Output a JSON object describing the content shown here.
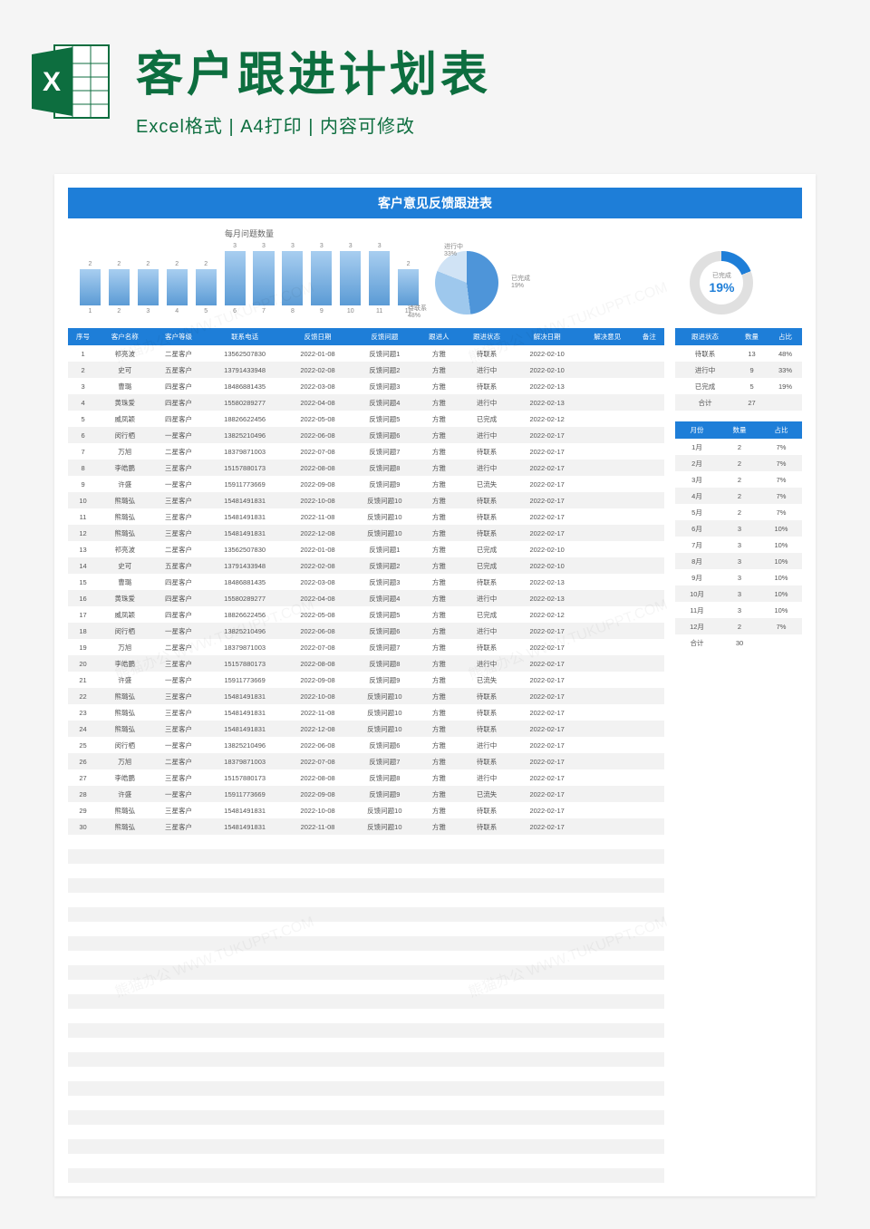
{
  "header": {
    "title": "客户跟进计划表",
    "subtitle": "Excel格式 | A4打印 | 内容可修改"
  },
  "sheet": {
    "title": "客户意见反馈跟进表",
    "barChartTitle": "每月问题数量",
    "donut": {
      "label": "已完成",
      "pct": "19%"
    },
    "pieLegend": [
      {
        "name": "已完成",
        "pct": "19%"
      },
      {
        "name": "待联系",
        "pct": "48%"
      },
      {
        "name": "进行中",
        "pct": "33%"
      }
    ]
  },
  "chart_data": {
    "bar": {
      "type": "bar",
      "title": "每月问题数量",
      "categories": [
        "1",
        "2",
        "3",
        "4",
        "5",
        "6",
        "7",
        "8",
        "9",
        "10",
        "11",
        "12"
      ],
      "values": [
        2,
        2,
        2,
        2,
        2,
        3,
        3,
        3,
        3,
        3,
        3,
        2
      ],
      "ylim": [
        0,
        3
      ]
    },
    "pie": {
      "type": "pie",
      "series": [
        {
          "name": "待联系",
          "value": 48
        },
        {
          "name": "进行中",
          "value": 33
        },
        {
          "name": "已完成",
          "value": 19
        }
      ]
    },
    "donut": {
      "type": "pie",
      "title": "已完成",
      "value": 19
    }
  },
  "mainHeaders": [
    "序号",
    "客户名称",
    "客户等级",
    "联系电话",
    "反馈日期",
    "反馈问题",
    "跟进人",
    "跟进状态",
    "解决日期",
    "解决意见",
    "备注"
  ],
  "mainRows": [
    [
      "1",
      "祁亮波",
      "二星客户",
      "13562507830",
      "2022-01-08",
      "反馈问题1",
      "方雅",
      "待联系",
      "2022-02-10",
      "",
      ""
    ],
    [
      "2",
      "史可",
      "五星客户",
      "13791433948",
      "2022-02-08",
      "反馈问题2",
      "方雅",
      "进行中",
      "2022-02-10",
      "",
      ""
    ],
    [
      "3",
      "曹璐",
      "四星客户",
      "18486881435",
      "2022-03-08",
      "反馈问题3",
      "方雅",
      "待联系",
      "2022-02-13",
      "",
      ""
    ],
    [
      "4",
      "黄珠爱",
      "四星客户",
      "15580289277",
      "2022-04-08",
      "反馈问题4",
      "方雅",
      "进行中",
      "2022-02-13",
      "",
      ""
    ],
    [
      "5",
      "威凤颖",
      "四星客户",
      "18826622456",
      "2022-05-08",
      "反馈问题5",
      "方雅",
      "已完成",
      "2022-02-12",
      "",
      ""
    ],
    [
      "6",
      "闵行栖",
      "一星客户",
      "13825210496",
      "2022-06-08",
      "反馈问题6",
      "方雅",
      "进行中",
      "2022-02-17",
      "",
      ""
    ],
    [
      "7",
      "万旭",
      "二星客户",
      "18379871003",
      "2022-07-08",
      "反馈问题7",
      "方雅",
      "待联系",
      "2022-02-17",
      "",
      ""
    ],
    [
      "8",
      "李皓鹏",
      "三星客户",
      "15157880173",
      "2022-08-08",
      "反馈问题8",
      "方雅",
      "进行中",
      "2022-02-17",
      "",
      ""
    ],
    [
      "9",
      "许盛",
      "一星客户",
      "15911773669",
      "2022-09-08",
      "反馈问题9",
      "方雅",
      "已流失",
      "2022-02-17",
      "",
      ""
    ],
    [
      "10",
      "熊璐弘",
      "三星客户",
      "15481491831",
      "2022-10-08",
      "反馈问题10",
      "方雅",
      "待联系",
      "2022-02-17",
      "",
      ""
    ],
    [
      "11",
      "熊璐弘",
      "三星客户",
      "15481491831",
      "2022-11-08",
      "反馈问题10",
      "方雅",
      "待联系",
      "2022-02-17",
      "",
      ""
    ],
    [
      "12",
      "熊璐弘",
      "三星客户",
      "15481491831",
      "2022-12-08",
      "反馈问题10",
      "方雅",
      "待联系",
      "2022-02-17",
      "",
      ""
    ],
    [
      "13",
      "祁亮波",
      "二星客户",
      "13562507830",
      "2022-01-08",
      "反馈问题1",
      "方雅",
      "已完成",
      "2022-02-10",
      "",
      ""
    ],
    [
      "14",
      "史可",
      "五星客户",
      "13791433948",
      "2022-02-08",
      "反馈问题2",
      "方雅",
      "已完成",
      "2022-02-10",
      "",
      ""
    ],
    [
      "15",
      "曹璐",
      "四星客户",
      "18486881435",
      "2022-03-08",
      "反馈问题3",
      "方雅",
      "待联系",
      "2022-02-13",
      "",
      ""
    ],
    [
      "16",
      "黄珠爱",
      "四星客户",
      "15580289277",
      "2022-04-08",
      "反馈问题4",
      "方雅",
      "进行中",
      "2022-02-13",
      "",
      ""
    ],
    [
      "17",
      "威凤颖",
      "四星客户",
      "18826622456",
      "2022-05-08",
      "反馈问题5",
      "方雅",
      "已完成",
      "2022-02-12",
      "",
      ""
    ],
    [
      "18",
      "闵行栖",
      "一星客户",
      "13825210496",
      "2022-06-08",
      "反馈问题6",
      "方雅",
      "进行中",
      "2022-02-17",
      "",
      ""
    ],
    [
      "19",
      "万旭",
      "二星客户",
      "18379871003",
      "2022-07-08",
      "反馈问题7",
      "方雅",
      "待联系",
      "2022-02-17",
      "",
      ""
    ],
    [
      "20",
      "李皓鹏",
      "三星客户",
      "15157880173",
      "2022-08-08",
      "反馈问题8",
      "方雅",
      "进行中",
      "2022-02-17",
      "",
      ""
    ],
    [
      "21",
      "许盛",
      "一星客户",
      "15911773669",
      "2022-09-08",
      "反馈问题9",
      "方雅",
      "已流失",
      "2022-02-17",
      "",
      ""
    ],
    [
      "22",
      "熊璐弘",
      "三星客户",
      "15481491831",
      "2022-10-08",
      "反馈问题10",
      "方雅",
      "待联系",
      "2022-02-17",
      "",
      ""
    ],
    [
      "23",
      "熊璐弘",
      "三星客户",
      "15481491831",
      "2022-11-08",
      "反馈问题10",
      "方雅",
      "待联系",
      "2022-02-17",
      "",
      ""
    ],
    [
      "24",
      "熊璐弘",
      "三星客户",
      "15481491831",
      "2022-12-08",
      "反馈问题10",
      "方雅",
      "待联系",
      "2022-02-17",
      "",
      ""
    ],
    [
      "25",
      "闵行栖",
      "一星客户",
      "13825210496",
      "2022-06-08",
      "反馈问题6",
      "方雅",
      "进行中",
      "2022-02-17",
      "",
      ""
    ],
    [
      "26",
      "万旭",
      "二星客户",
      "18379871003",
      "2022-07-08",
      "反馈问题7",
      "方雅",
      "待联系",
      "2022-02-17",
      "",
      ""
    ],
    [
      "27",
      "李皓鹏",
      "三星客户",
      "15157880173",
      "2022-08-08",
      "反馈问题8",
      "方雅",
      "进行中",
      "2022-02-17",
      "",
      ""
    ],
    [
      "28",
      "许盛",
      "一星客户",
      "15911773669",
      "2022-09-08",
      "反馈问题9",
      "方雅",
      "已流失",
      "2022-02-17",
      "",
      ""
    ],
    [
      "29",
      "熊璐弘",
      "三星客户",
      "15481491831",
      "2022-10-08",
      "反馈问题10",
      "方雅",
      "待联系",
      "2022-02-17",
      "",
      ""
    ],
    [
      "30",
      "熊璐弘",
      "三星客户",
      "15481491831",
      "2022-11-08",
      "反馈问题10",
      "方雅",
      "待联系",
      "2022-02-17",
      "",
      ""
    ]
  ],
  "statusHeaders": [
    "跟进状态",
    "数量",
    "占比"
  ],
  "statusRows": [
    [
      "待联系",
      "13",
      "48%"
    ],
    [
      "进行中",
      "9",
      "33%"
    ],
    [
      "已完成",
      "5",
      "19%"
    ],
    [
      "合计",
      "27",
      ""
    ]
  ],
  "monthHeaders": [
    "月份",
    "数量",
    "占比"
  ],
  "monthRows": [
    [
      "1月",
      "2",
      "7%"
    ],
    [
      "2月",
      "2",
      "7%"
    ],
    [
      "3月",
      "2",
      "7%"
    ],
    [
      "4月",
      "2",
      "7%"
    ],
    [
      "5月",
      "2",
      "7%"
    ],
    [
      "6月",
      "3",
      "10%"
    ],
    [
      "7月",
      "3",
      "10%"
    ],
    [
      "8月",
      "3",
      "10%"
    ],
    [
      "9月",
      "3",
      "10%"
    ],
    [
      "10月",
      "3",
      "10%"
    ],
    [
      "11月",
      "3",
      "10%"
    ],
    [
      "12月",
      "2",
      "7%"
    ],
    [
      "合计",
      "30",
      ""
    ]
  ],
  "watermark": "熊猫办公 WWW.TUKUPPT.COM"
}
